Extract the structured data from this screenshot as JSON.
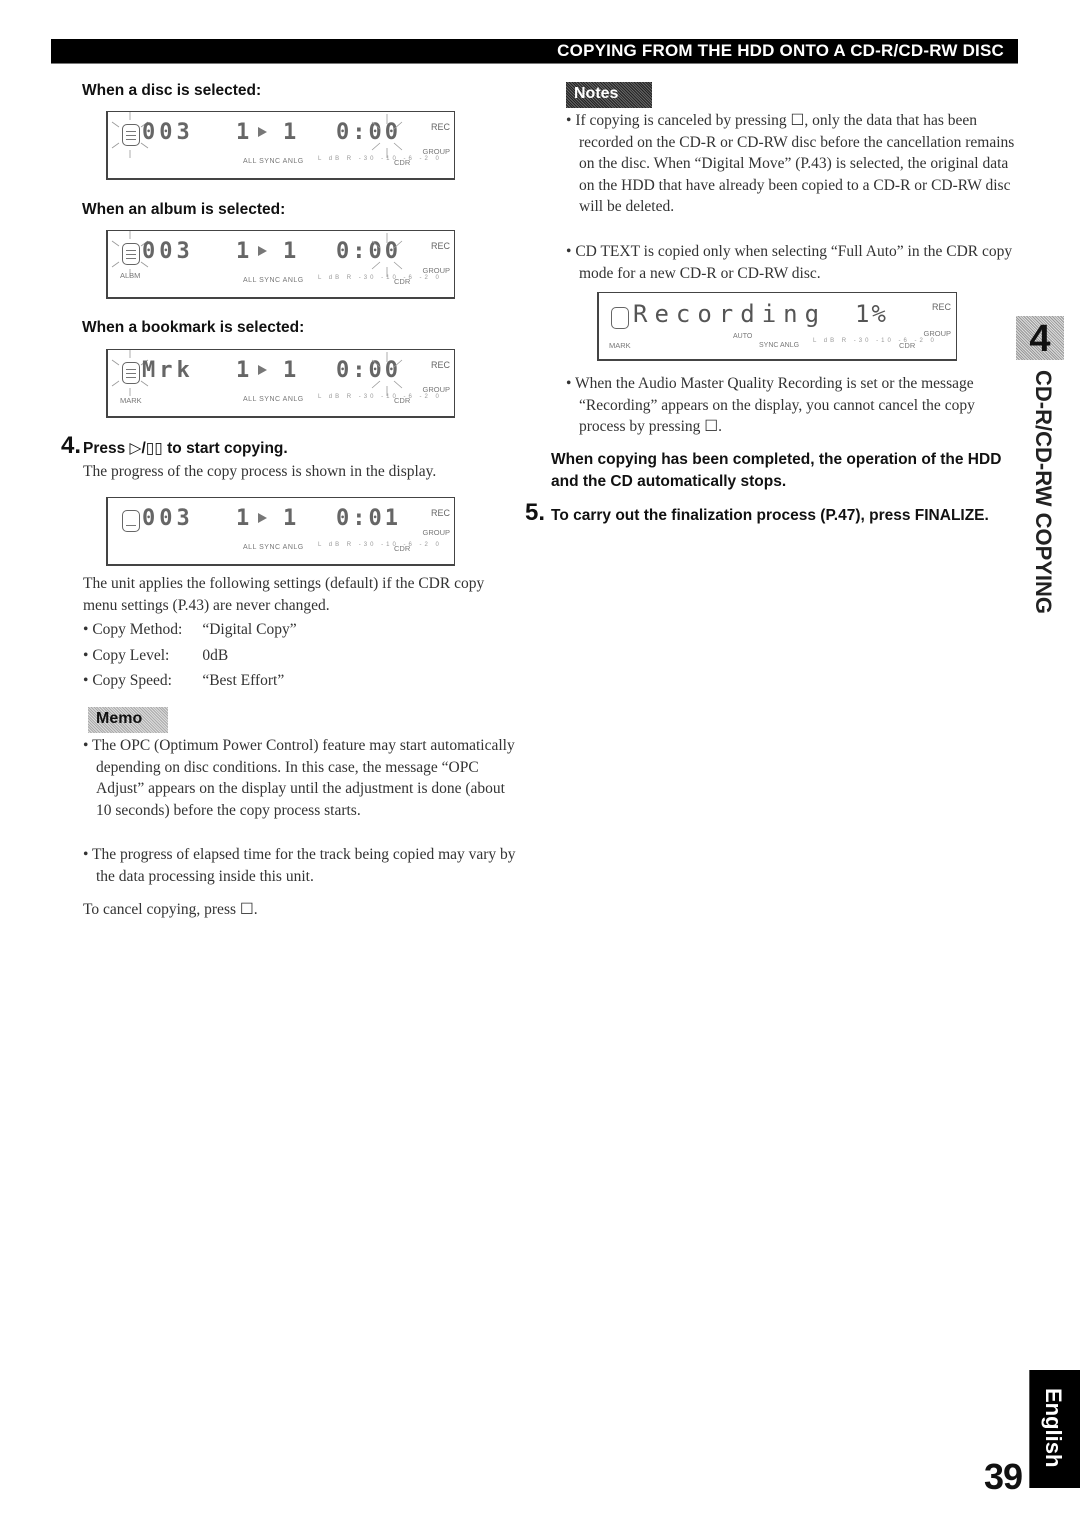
{
  "header": {
    "title": "COPYING FROM THE HDD ONTO A CD-R/CD-RW DISC"
  },
  "left": {
    "disc_heading": "When a disc is selected:",
    "album_heading": "When an album is selected:",
    "bookmark_heading": "When a bookmark is selected:",
    "displays": {
      "disc": {
        "main": "003",
        "track": "1",
        "track2": "1",
        "time": "0:00",
        "rec": "REC",
        "group": "GROUP",
        "cdr": "CDR",
        "meter": "ALL SYNC ANLG",
        "scale": "L dB R -30 -10 -6 -2 0",
        "sub_label": ""
      },
      "album": {
        "main": "003",
        "track": "1",
        "track2": "1",
        "time": "0:00",
        "rec": "REC",
        "group": "GROUP",
        "cdr": "CDR",
        "meter": "ALL SYNC ANLG",
        "scale": "L dB R -30 -10 -6 -2 0",
        "sub_label": "ALBM"
      },
      "bookmark": {
        "main": "Mrk",
        "track": "1",
        "track2": "1",
        "time": "0:00",
        "rec": "REC",
        "group": "GROUP",
        "cdr": "CDR",
        "meter": "ALL SYNC ANLG",
        "scale": "L dB R -30 -10 -6 -2 0",
        "sub_label": "MARK"
      },
      "copying": {
        "main": "003",
        "track": "1",
        "track2": "1",
        "time": "0:01",
        "rec": "REC",
        "group": "GROUP",
        "cdr": "CDR",
        "meter": "ALL SYNC ANLG",
        "scale": "L dB R -30 -10 -6 -2 0",
        "sub_label": ""
      }
    },
    "step4": {
      "number": "4.",
      "instruction": "Press ▷/▯▯ to start copying.",
      "description": "The progress of the copy process is shown in the display."
    },
    "defaults_intro": "The unit applies the following settings (default) if the CDR copy menu settings (P.43) are never changed.",
    "defaults": [
      {
        "label": "Copy Method:",
        "value": "“Digital Copy”"
      },
      {
        "label": "Copy Level:",
        "value": "0dB"
      },
      {
        "label": "Copy Speed:",
        "value": "“Best Effort”"
      }
    ],
    "memo": {
      "label": "Memo",
      "items": [
        "The OPC (Optimum Power Control) feature may start automatically depending on disc conditions. In this case, the message “OPC Adjust” appears on the display until the adjustment is done (about 10 seconds) before the copy process starts.",
        "The progress of elapsed time for the track being copied may vary by the data processing inside this unit."
      ]
    },
    "cancel_text": "To cancel copying, press ☐."
  },
  "right": {
    "notes": {
      "label": "Notes",
      "items": [
        "If copying is canceled by pressing ☐, only the data that has been recorded on the CD-R or CD-RW disc before the cancellation remains on the disc. When “Digital Move” (P.43) is selected, the original data on the HDD that have already been copied to a CD-R or CD-RW disc will be deleted.",
        "CD TEXT is copied only when selecting “Full Auto” in the CDR copy mode for a new CD-R or CD-RW disc."
      ]
    },
    "recording_display": {
      "word": "Recording",
      "percent": "1%",
      "rec": "REC",
      "group": "GROUP",
      "cdr": "CDR",
      "auto": "AUTO",
      "meter": "SYNC ANLG",
      "scale": "L dB R -30 -10 -6 -2 0",
      "sub_label": "MARK"
    },
    "recording_note": "When the Audio Master Quality Recording is set or the message “Recording” appears on the display, you cannot cancel the copy process by pressing ☐.",
    "completion_text": "When copying has been completed, the operation of the HDD and the CD automatically stops.",
    "step5": {
      "number": "5.",
      "instruction": "To carry out the finalization process (P.47), press FINALIZE."
    }
  },
  "side": {
    "chapter_number": "4",
    "chapter_label": "CD-R/CD-RW COPYING",
    "language_tab": "English",
    "page_number": "39"
  }
}
